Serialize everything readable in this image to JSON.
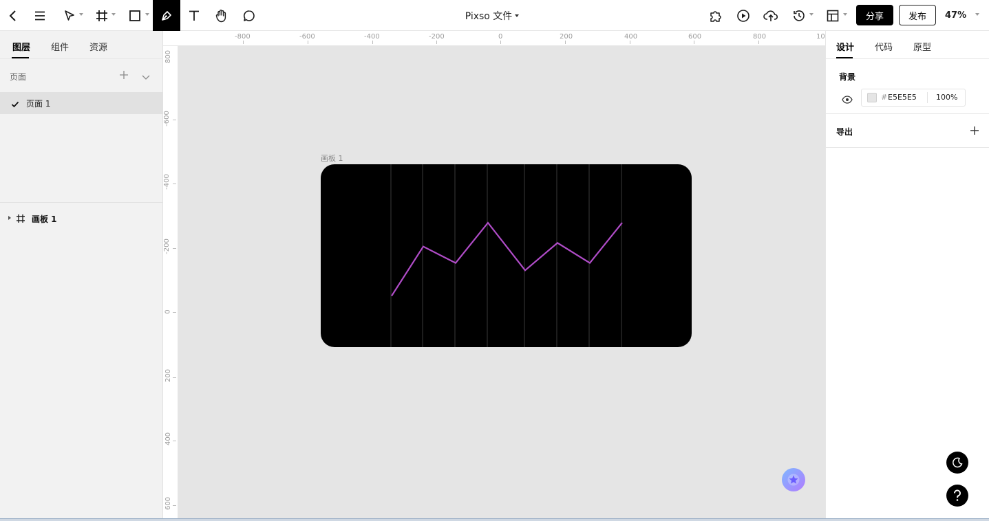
{
  "topbar": {
    "doc_title": "Pixso 文件",
    "share_label": "分享",
    "publish_label": "发布",
    "zoom_label": "47%",
    "tools": [
      "back-icon",
      "menu-icon",
      "move-tool-icon",
      "frame-tool-icon",
      "rectangle-tool-icon",
      "pen-tool-icon",
      "text-tool-icon",
      "hand-tool-icon",
      "comment-tool-icon"
    ],
    "right_icons": [
      "plugin-icon",
      "play-icon",
      "upload-icon",
      "history-icon",
      "layout-icon"
    ],
    "active_tool": "pen-tool-icon"
  },
  "left_panel": {
    "tabs": [
      "图层",
      "组件",
      "资源"
    ],
    "active_tab": "图层",
    "pages_label": "页面",
    "pages": [
      {
        "name": "页面 1",
        "selected": true
      }
    ],
    "layers": [
      {
        "name": "画板 1",
        "type": "frame"
      }
    ]
  },
  "rulers": {
    "top_ticks": [
      "-800",
      "-600",
      "-400",
      "-200",
      "0",
      "200",
      "400",
      "600",
      "800",
      "10"
    ],
    "left_ticks": [
      "800",
      "-600",
      "-400",
      "-200",
      "0",
      "200",
      "400",
      "600"
    ]
  },
  "canvas": {
    "background": "#E5E5E5",
    "frame_label": "画板 1",
    "artboard_fill": "#000000",
    "line_color": "#B04CC8",
    "gridline_color": "#3A3A3A",
    "polyline_values": [
      0.28,
      0.55,
      0.46,
      0.68,
      0.42,
      0.57,
      0.46,
      0.68
    ]
  },
  "right_panel": {
    "tabs": [
      "设计",
      "代码",
      "原型"
    ],
    "active_tab": "设计",
    "background_title": "背景",
    "background_hash": "#",
    "background_hex": "E5E5E5",
    "background_opacity": "100",
    "background_opacity_unit": "%",
    "export_title": "导出"
  }
}
